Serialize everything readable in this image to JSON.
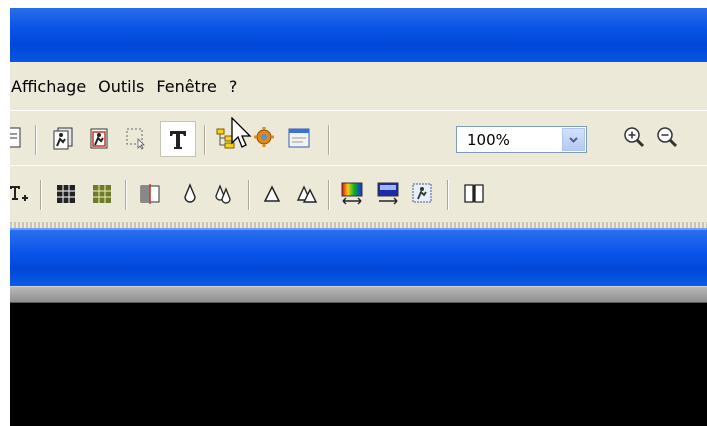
{
  "menubar": {
    "items": [
      "Affichage",
      "Outils",
      "Fenêtre",
      "?"
    ]
  },
  "toolbar": {
    "zoom_value": "100%"
  },
  "icons": {
    "row1": [
      "page-icon",
      "page-person-icon",
      "page-person-red-icon",
      "marquee-select-icon",
      "text-tool-icon",
      "site-tree-icon",
      "gear-icon",
      "window-icon",
      "zoom-in-icon",
      "zoom-out-icon"
    ],
    "row2": [
      "text-add-icon",
      "grid-black-icon",
      "grid-olive-icon",
      "split-fill-icon",
      "droplet-icon",
      "double-droplet-icon",
      "triangle-icon",
      "double-triangle-icon",
      "rainbow-swap-icon",
      "monitor-swap-icon",
      "stamp-icon",
      "book-icon"
    ]
  },
  "colors": {
    "title_blue": "#0a56e9",
    "menu_bg": "#ece9d8"
  }
}
